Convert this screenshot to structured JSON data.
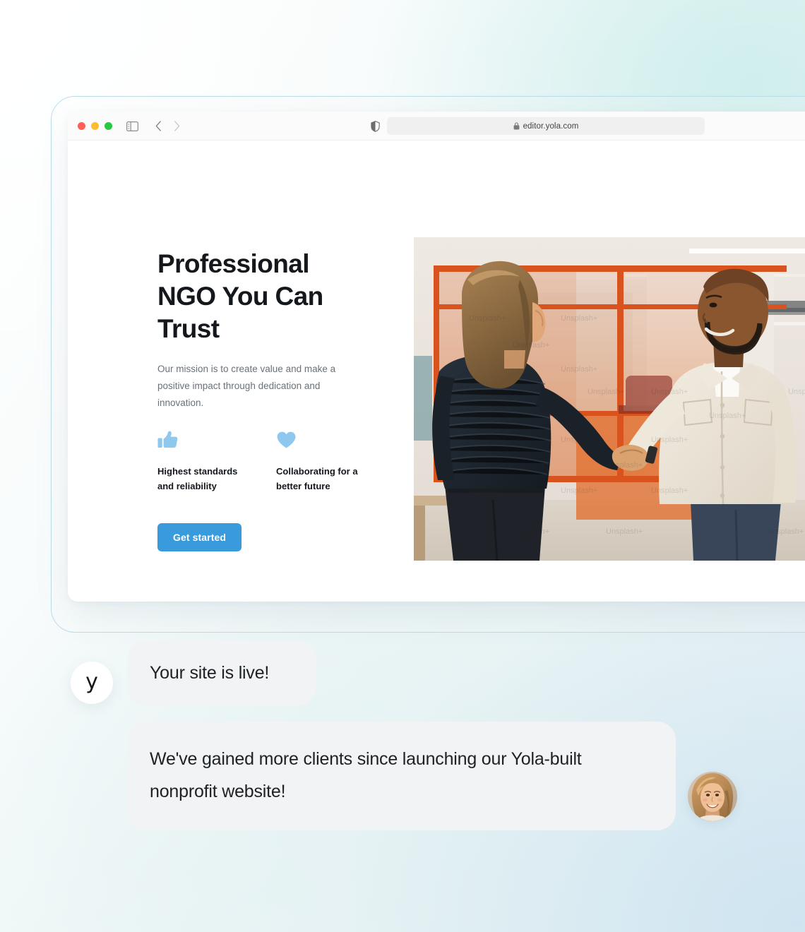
{
  "browser": {
    "traffic_lights": [
      "close",
      "minimize",
      "maximize"
    ],
    "url": "editor.yola.com",
    "lock_icon": "lock-icon",
    "sidebar_icon": "sidebar-toggle-icon",
    "back_icon": "chevron-left-icon",
    "forward_icon": "chevron-right-icon",
    "shield_icon": "shield-icon",
    "reload_icon": "reload-icon"
  },
  "site": {
    "heading": "Professional NGO You Can Trust",
    "subheading": "Our mission is to create value and make a positive impact through dedication and innovation.",
    "features": [
      {
        "icon": "thumbs-up-icon",
        "label": "Highest standards and reliability"
      },
      {
        "icon": "heart-icon",
        "label": "Collaborating for a better future"
      }
    ],
    "cta_label": "Get started",
    "hero_image_alt": "Two people shaking hands in an office with orange glass partitions"
  },
  "chat": {
    "brand_letter": "y",
    "messages": [
      {
        "text": "Your site is live!"
      },
      {
        "text": "We've gained more clients since launching our Yola-built nonprofit website!"
      }
    ],
    "avatar_alt": "Smiling woman with long light brown hair"
  },
  "colors": {
    "accent": "#3a9bdc",
    "feature_icon": "#8ec8ee",
    "bubble_bg": "#f1f3f4",
    "heading": "#14181d",
    "body_text": "#6b7177",
    "frame_border": "#bcdcec"
  }
}
